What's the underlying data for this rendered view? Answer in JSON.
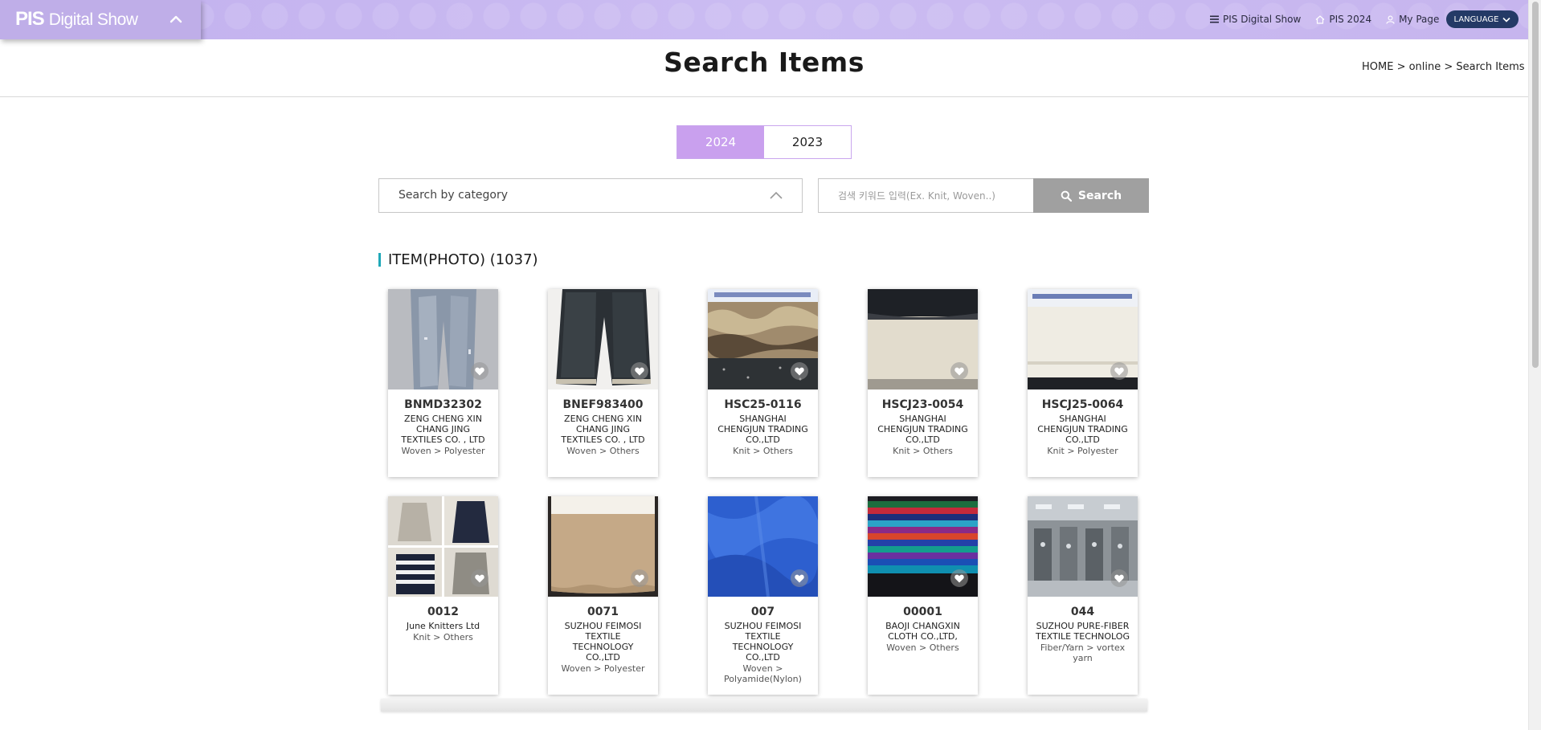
{
  "header": {
    "logo_bold": "PIS",
    "logo_rest": "Digital Show",
    "nav": [
      {
        "label": "PIS Digital Show",
        "icon": "menu-icon"
      },
      {
        "label": "PIS 2024",
        "icon": "home-icon"
      },
      {
        "label": "My Page",
        "icon": "user-icon"
      }
    ],
    "language_label": "LANGUAGE"
  },
  "page": {
    "title": "Search Items",
    "breadcrumb": "HOME > online > Search Items"
  },
  "year_tabs": [
    {
      "label": "2024",
      "active": true
    },
    {
      "label": "2023",
      "active": false
    }
  ],
  "search": {
    "category_label": "Search by category",
    "keyword_placeholder": "검색 키워드 입력(Ex. Knit, Woven..)",
    "button_label": "Search"
  },
  "section": {
    "title": "ITEM(PHOTO) (1037)"
  },
  "items": [
    {
      "code": "BNMD32302",
      "company": "ZENG CHENG XIN CHANG JING TEXTILES CO. , LTD",
      "category": "Woven > Polyester",
      "image": "light-denim-jeans"
    },
    {
      "code": "BNEF983400",
      "company": "ZENG CHENG XIN CHANG JING TEXTILES CO. , LTD",
      "category": "Woven > Others",
      "image": "dark-denim-pants"
    },
    {
      "code": "HSC25-0116",
      "company": "SHANGHAI CHENGJUN TRADING CO.,LTD",
      "category": "Knit > Others",
      "image": "faux-fur-swatch"
    },
    {
      "code": "HSCJ23-0054",
      "company": "SHANGHAI CHENGJUN TRADING CO.,LTD",
      "category": "Knit > Others",
      "image": "cream-fleece-swatch"
    },
    {
      "code": "HSCJ25-0064",
      "company": "SHANGHAI CHENGJUN TRADING CO.,LTD",
      "category": "Knit > Polyester",
      "image": "white-sherpa-swatch"
    },
    {
      "code": "0012",
      "company": "June Knitters Ltd",
      "category": "Knit > Others",
      "image": "knitwear-collage"
    },
    {
      "code": "0071",
      "company": "SUZHOU FEIMOSI TEXTILE TECHNOLOGY CO.,LTD",
      "category": "Woven > Polyester",
      "image": "tan-fabric-swatch"
    },
    {
      "code": "007",
      "company": "SUZHOU FEIMOSI TEXTILE TECHNOLOGY CO.,LTD",
      "category": "Woven > Polyamide(Nylon)",
      "image": "blue-nylon-fabric"
    },
    {
      "code": "00001",
      "company": "BAOJI CHANGXIN CLOTH CO.,LTD,",
      "category": "Woven > Others",
      "image": "colorful-fabric-stack"
    },
    {
      "code": "044",
      "company": "SUZHOU PURE-FIBER TEXTILE TECHNOLOG",
      "category": "Fiber/Yarn > vortex yarn",
      "image": "factory-machinery"
    }
  ],
  "colors": {
    "header_bg": "#c6b6ee",
    "tab_active": "#c9a0ee",
    "search_button": "#a0a0a0",
    "section_accent": "#1fa8b8",
    "language_button": "#243a66"
  }
}
